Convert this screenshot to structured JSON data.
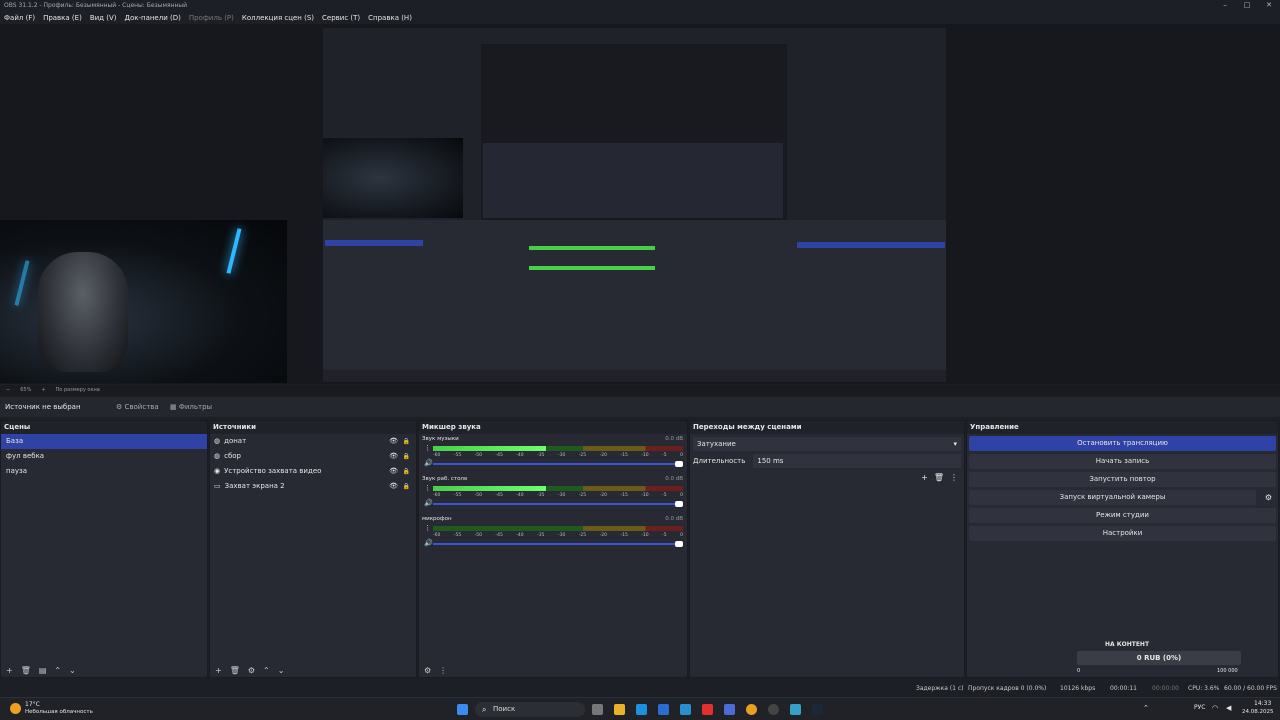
{
  "window": {
    "title": "OBS 31.1.2 - Профиль: Безымянный - Сцены: Безымянный"
  },
  "menu": [
    "Файл (F)",
    "Правка (E)",
    "Вид (V)",
    "Док-панели (D)",
    "Профиль (P)",
    "Коллекция сцен (S)",
    "Сервис (T)",
    "Справка (H)"
  ],
  "zoom": {
    "value": "65%",
    "mode": "По размеру окна"
  },
  "source_bar": {
    "status": "Источник не выбран",
    "properties": "Свойства",
    "filters": "Фильтры"
  },
  "scenes": {
    "title": "Сцены",
    "items": [
      "База",
      "фул вебка",
      "пауза"
    ],
    "selected": 0
  },
  "sources": {
    "title": "Источники",
    "items": [
      {
        "label": "донат",
        "icon": "browser-icon"
      },
      {
        "label": "сбор",
        "icon": "browser-icon"
      },
      {
        "label": "Устройство захвата видео",
        "icon": "camera-icon"
      },
      {
        "label": "Захват экрана 2",
        "icon": "monitor-icon"
      }
    ]
  },
  "mixer": {
    "title": "Микшер звука",
    "channels": [
      {
        "name": "Звук музыки",
        "db": "0.0 dB",
        "level": 0.45
      },
      {
        "name": "Звук раб. столе",
        "db": "0.0 dB",
        "level": 0.45
      },
      {
        "name": "микрофон",
        "db": "0.0 dB",
        "level": 0.0
      }
    ],
    "scale": [
      "-60",
      "-55",
      "-50",
      "-45",
      "-40",
      "-35",
      "-30",
      "-25",
      "-20",
      "-15",
      "-10",
      "-5",
      "0"
    ]
  },
  "transitions": {
    "title": "Переходы между сценами",
    "selected": "Затухание",
    "duration_label": "Длительность",
    "duration_value": "150 ms"
  },
  "controls": {
    "title": "Управление",
    "buttons": [
      "Остановить трансляцию",
      "Начать запись",
      "Запустить повтор",
      "Запуск виртуальной камеры",
      "Режим студии",
      "Настройки"
    ],
    "active": 0
  },
  "donation": {
    "title": "НА КОНТЕНТ",
    "amount": "0 RUB (0%)",
    "min": "0",
    "max": "100 000",
    "progress": 0
  },
  "status": {
    "delay": "Задержка (1 с)",
    "dropped": "Пропуск кадров 0 (0.0%)",
    "bitrate": "10126 kbps",
    "live_time": "00:00:11",
    "rec_time": "00:00:00",
    "cpu": "CPU: 3.6%",
    "fps": "60.00 / 60.00 FPS"
  },
  "taskbar": {
    "weather_temp": "17°C",
    "weather_desc": "Небольшая облачность",
    "search": "Поиск",
    "lang": "РУС",
    "time": "14:33",
    "date": "24.08.2025"
  },
  "colors": {
    "accent": "#2f43a6",
    "panel": "#272a33",
    "bg": "#1d1f26"
  }
}
